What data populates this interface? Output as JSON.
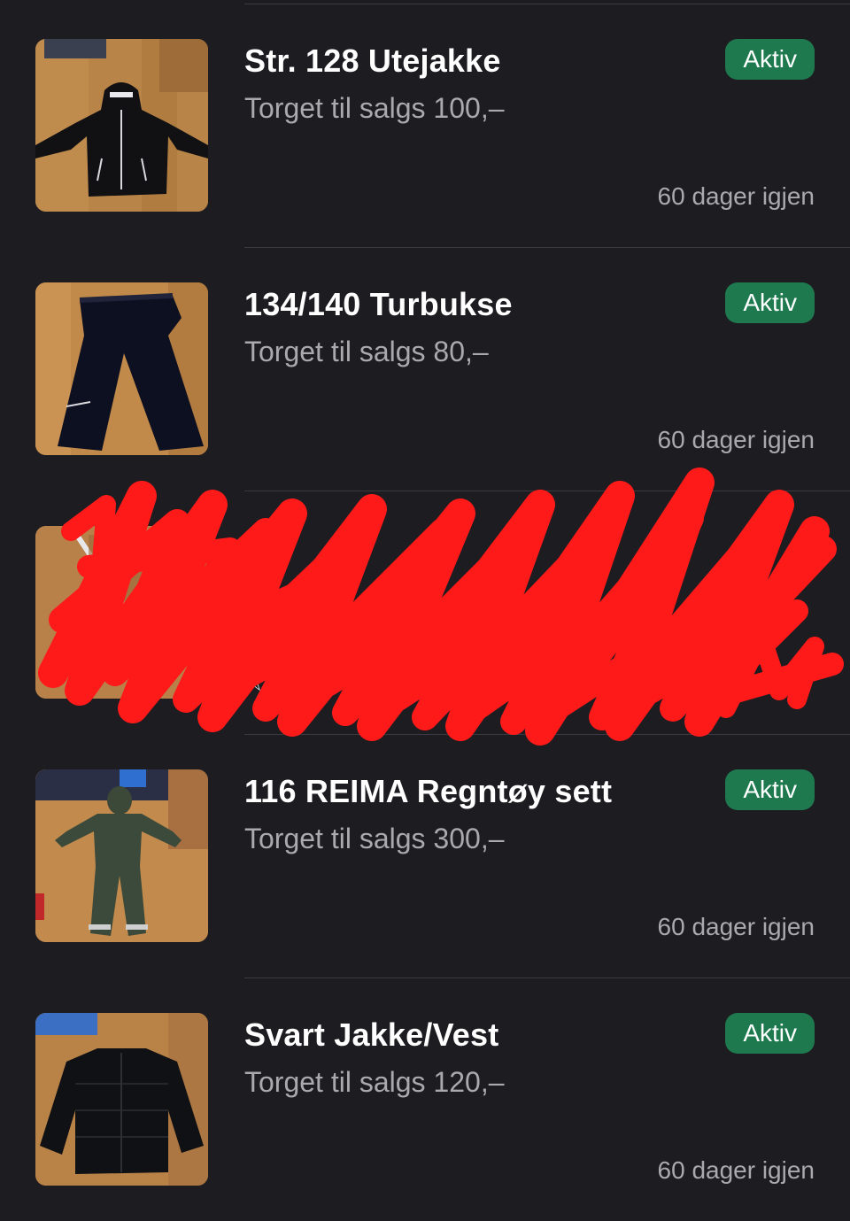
{
  "listings": [
    {
      "title": "Str. 128 Utejakke",
      "subtitle": "Torget til salgs 100,–",
      "status": "Aktiv",
      "remaining": "60 dager igjen",
      "thumbnail_icon": "jacket-photo"
    },
    {
      "title": "134/140 Turbukse",
      "subtitle": "Torget til salgs 80,–",
      "status": "Aktiv",
      "remaining": "60 dager igjen",
      "thumbnail_icon": "pants-photo"
    },
    {
      "title": "",
      "subtitle": "",
      "status": "",
      "remaining": "",
      "count": "1",
      "thumbnail_icon": "redacted-photo",
      "redacted": true
    },
    {
      "title": "116 REIMA Regntøy sett",
      "subtitle": "Torget til salgs 300,–",
      "status": "Aktiv",
      "remaining": "60 dager igjen",
      "thumbnail_icon": "rainwear-photo"
    },
    {
      "title": "Svart Jakke/Vest",
      "subtitle": "Torget til salgs 120,–",
      "status": "Aktiv",
      "remaining": "60 dager igjen",
      "thumbnail_icon": "puffer-jacket-photo"
    }
  ],
  "colors": {
    "background": "#1c1c21",
    "badge": "#1e7a4e",
    "muted_text": "#a9a9ae",
    "redaction": "#ff1a1a"
  }
}
